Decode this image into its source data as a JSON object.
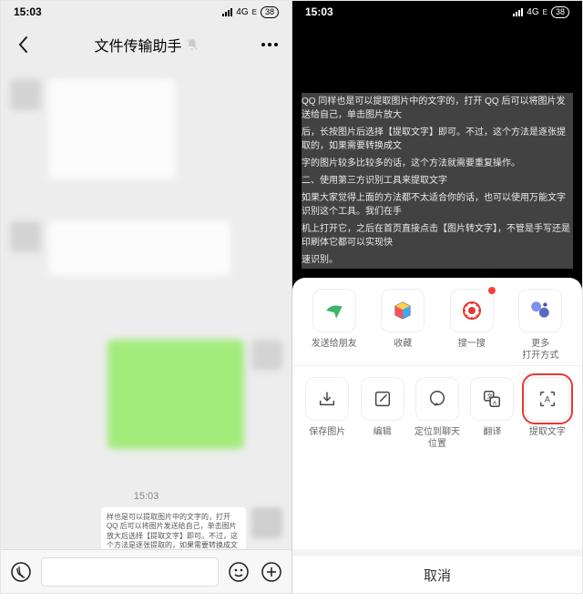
{
  "status": {
    "time": "15:03",
    "network": "4G",
    "signal_sub": "E",
    "battery": "38"
  },
  "chat": {
    "title": "文件传输助手",
    "timestamp": "15:03",
    "note_text": "样也是可以提取图片中的文字的，打开 QQ 后可以将图片发送给自己，单击图片放大后选择【提取文字】即可。不过，这个方法是逐张提取的，如果需要转换成文本…使用第三方识别工具来提取文字 如果大家觉得上面的方法都不太适合你的话，也可以使用万能文字识别这个工具…"
  },
  "viewer": {
    "ocr_lines": [
      "QQ 同样也是可以提取图片中的文字的，打开 QQ 后可以将图片发送给自己，单击图片放大",
      "后，长按图片后选择【提取文字】即可。不过，这个方法是逐张提取的，如果需要转换成文",
      "字的图片较多比较多的话，这个方法就需要重复操作。",
      "二、使用第三方识别工具来提取文字",
      "如果大家觉得上面的方法都不太适合你的话，也可以使用万能文字识别这个工具。我们在手",
      "机上打开它，之后在首页直接点击【图片转文字】，不管是手写还是印刷体它都可以实现快",
      "速识别。"
    ]
  },
  "sheet": {
    "row1": [
      {
        "label": "发送给朋友",
        "icon": "share"
      },
      {
        "label": "收藏",
        "icon": "cube"
      },
      {
        "label": "搜一搜",
        "icon": "star",
        "dot": true
      },
      {
        "label": "更多\n打开方式",
        "icon": "links"
      }
    ],
    "row2": [
      {
        "label": "保存图片",
        "icon": "download"
      },
      {
        "label": "编辑",
        "icon": "edit"
      },
      {
        "label": "定位到聊天\n位置",
        "icon": "chat"
      },
      {
        "label": "翻译",
        "icon": "translate"
      },
      {
        "label": "提取文字",
        "icon": "extract",
        "highlight": true
      }
    ],
    "cancel": "取消"
  }
}
